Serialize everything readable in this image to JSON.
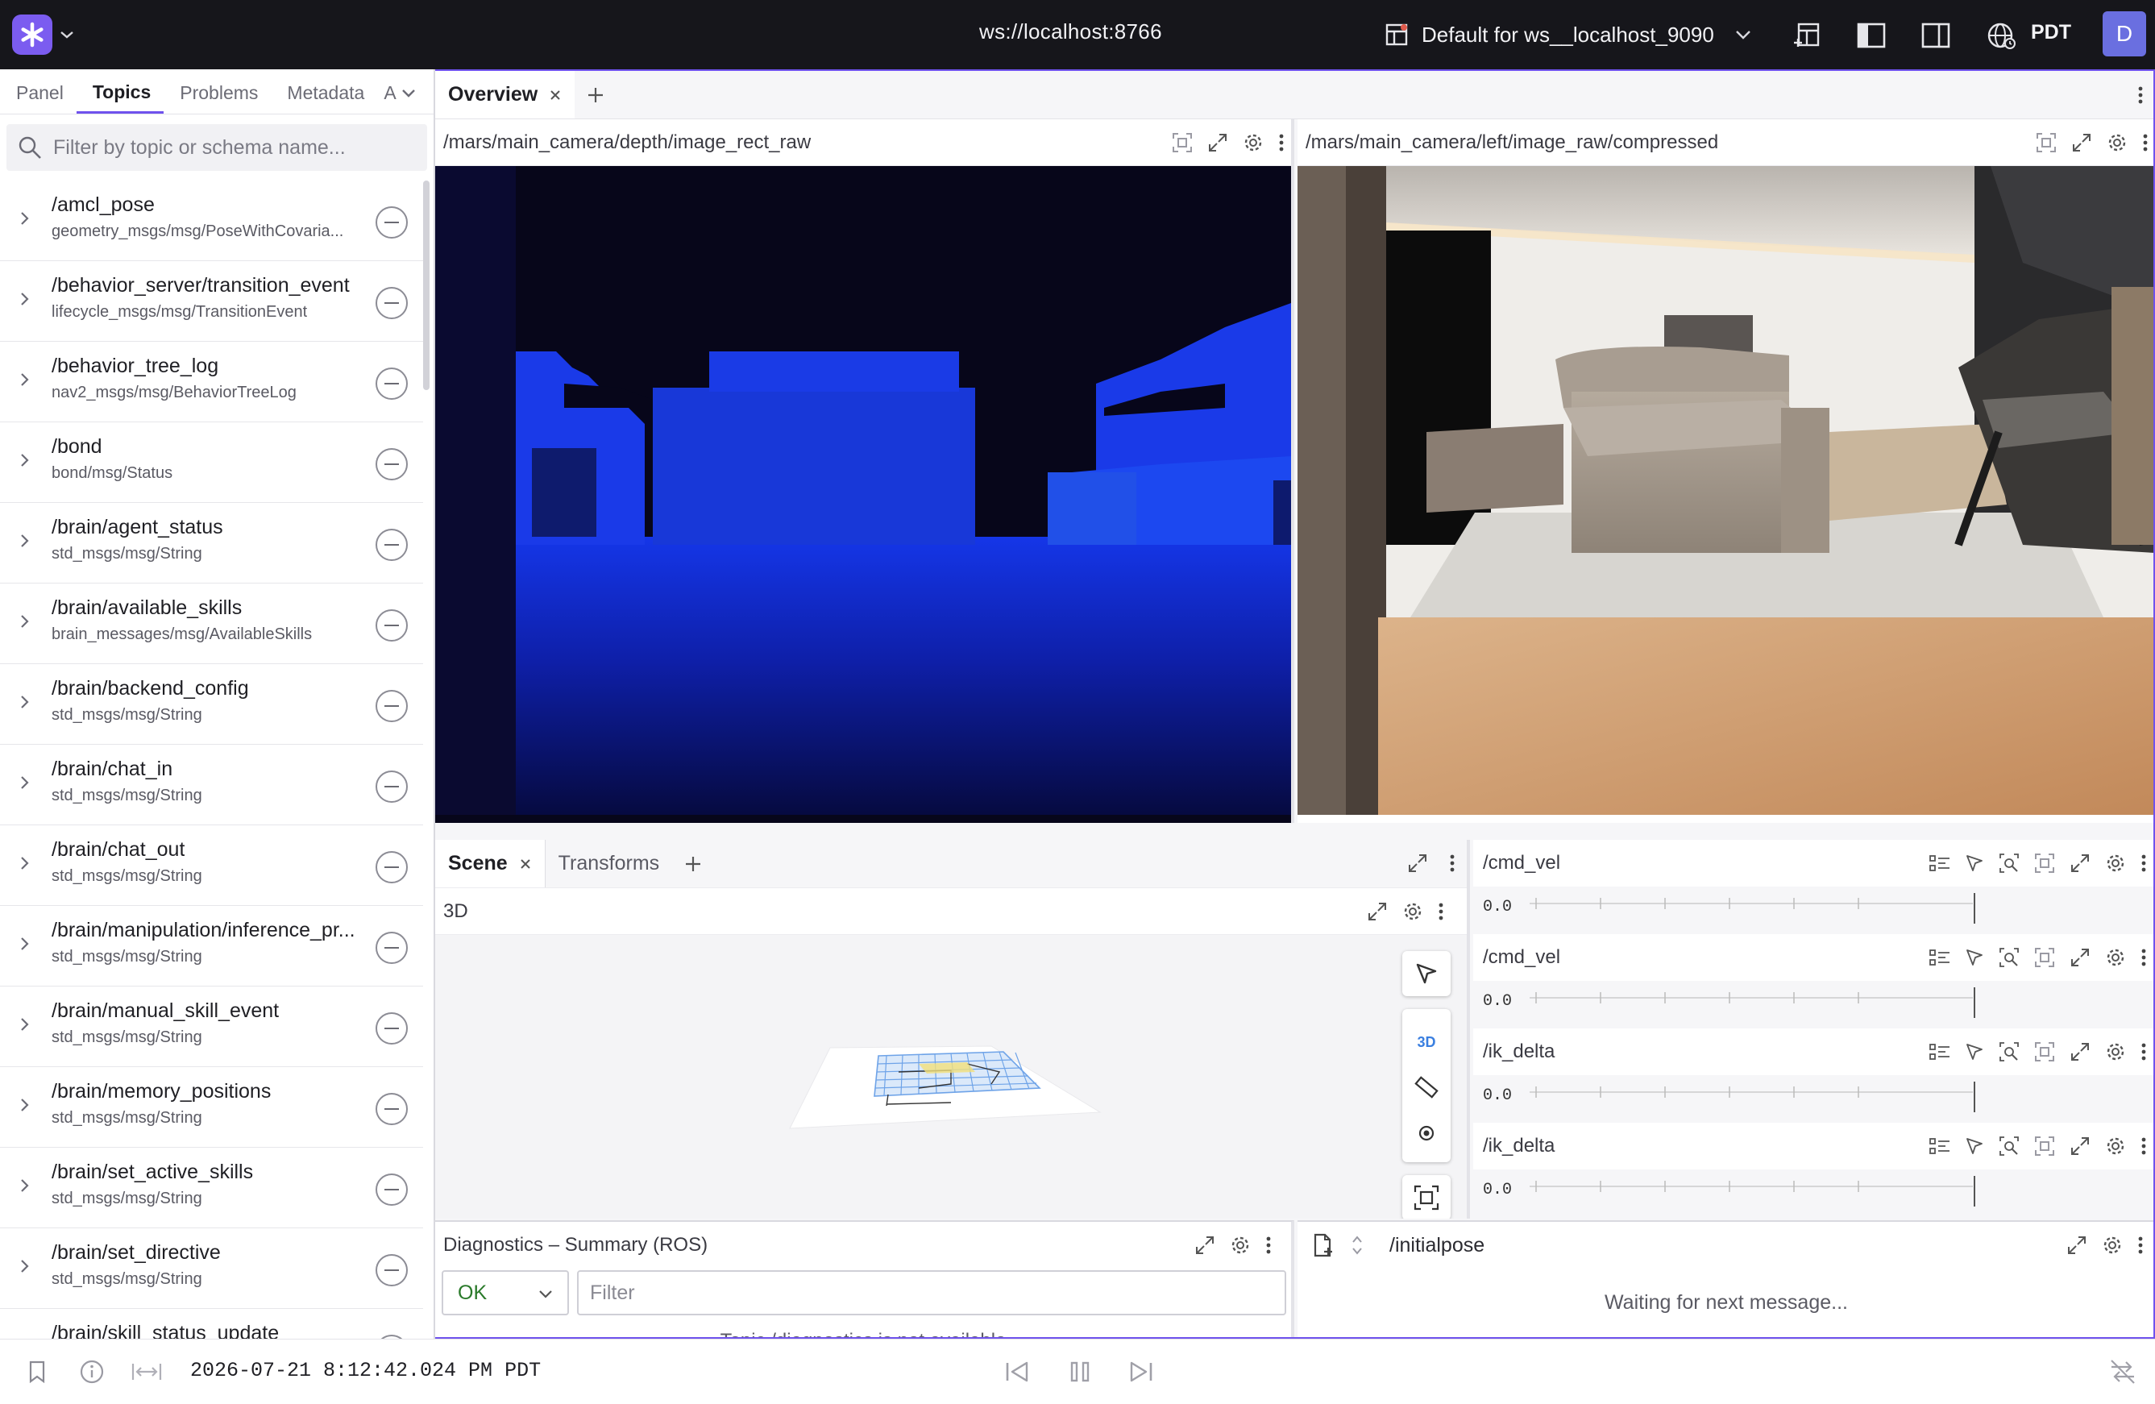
{
  "topbar": {
    "url": "ws://localhost:8766",
    "layout_name": "Default for ws__localhost_9090",
    "timezone": "PDT",
    "avatar_initial": "D"
  },
  "sidebar": {
    "tabs": [
      {
        "label": "Panel",
        "active": false
      },
      {
        "label": "Topics",
        "active": true
      },
      {
        "label": "Problems",
        "active": false
      },
      {
        "label": "Metadata",
        "active": false
      },
      {
        "label": "A",
        "active": false
      }
    ],
    "filter_placeholder": "Filter by topic or schema name...",
    "topics": [
      {
        "name": "/amcl_pose",
        "schema": "geometry_msgs/msg/PoseWithCovaria..."
      },
      {
        "name": "/behavior_server/transition_event",
        "schema": "lifecycle_msgs/msg/TransitionEvent"
      },
      {
        "name": "/behavior_tree_log",
        "schema": "nav2_msgs/msg/BehaviorTreeLog"
      },
      {
        "name": "/bond",
        "schema": "bond/msg/Status"
      },
      {
        "name": "/brain/agent_status",
        "schema": "std_msgs/msg/String"
      },
      {
        "name": "/brain/available_skills",
        "schema": "brain_messages/msg/AvailableSkills"
      },
      {
        "name": "/brain/backend_config",
        "schema": "std_msgs/msg/String"
      },
      {
        "name": "/brain/chat_in",
        "schema": "std_msgs/msg/String"
      },
      {
        "name": "/brain/chat_out",
        "schema": "std_msgs/msg/String"
      },
      {
        "name": "/brain/manipulation/inference_pr...",
        "schema": "std_msgs/msg/String"
      },
      {
        "name": "/brain/manual_skill_event",
        "schema": "std_msgs/msg/String"
      },
      {
        "name": "/brain/memory_positions",
        "schema": "std_msgs/msg/String"
      },
      {
        "name": "/brain/set_active_skills",
        "schema": "std_msgs/msg/String"
      },
      {
        "name": "/brain/set_directive",
        "schema": "std_msgs/msg/String"
      },
      {
        "name": "/brain/skill_status_update",
        "schema": ""
      }
    ]
  },
  "main": {
    "tab_label": "Overview",
    "depth_title": "/mars/main_camera/depth/image_rect_raw",
    "camera_title": "/mars/main_camera/left/image_raw/compressed",
    "scene_tabs": [
      "Scene",
      "Transforms"
    ],
    "scene_subtitle": "3D",
    "scene_3d_button": "3D",
    "plots": [
      {
        "title": "/cmd_vel",
        "axis_value": "0.0"
      },
      {
        "title": "/cmd_vel",
        "axis_value": "0.0"
      },
      {
        "title": "/ik_delta",
        "axis_value": "0.0"
      },
      {
        "title": "/ik_delta",
        "axis_value": "0.0"
      }
    ],
    "diagnostics": {
      "title": "Diagnostics – Summary (ROS)",
      "level": "OK",
      "filter_placeholder": "Filter",
      "notice": "Topic /diagnostics is not available"
    },
    "raw": {
      "title": "/initialpose",
      "waiting": "Waiting for next message..."
    }
  },
  "playback": {
    "timestamp": "2026-07-21 8:12:42.024 PM PDT"
  },
  "colors": {
    "accent": "#6f52ed",
    "topbar_bg": "#16161b",
    "ok_green": "#2a7a2a"
  }
}
